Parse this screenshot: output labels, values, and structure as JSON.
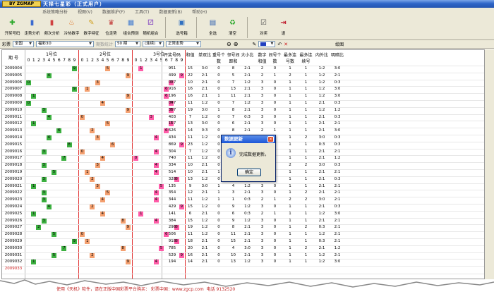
{
  "app": {
    "brand": "BY ZGMAP",
    "title": "天择七星彩（正式用户）"
  },
  "menu": [
    "系统策略分析",
    "视图(V)",
    "数据维护(F)",
    "工具(T)",
    "数据更新(B)",
    "帮助(H)"
  ],
  "toolbar": [
    {
      "label": "开奖号码",
      "icon": "plus-icon",
      "color": "#2aa82a"
    },
    {
      "label": "走势分析",
      "icon": "bar-chart-icon",
      "color": "#3a6ad0"
    },
    {
      "label": "频次分析",
      "icon": "bar-chart-icon",
      "color": "#d04040"
    },
    {
      "label": "冷热数字",
      "icon": "fire-icon",
      "color": "#e07020"
    },
    {
      "label": "数字特征",
      "icon": "pencil-icon",
      "color": "#d0a020"
    },
    {
      "label": "位走势",
      "icon": "cup-icon",
      "color": "#c03030"
    },
    {
      "label": "组合预测",
      "icon": "grid-icon",
      "color": "#4a80d0"
    },
    {
      "label": "随机组合",
      "icon": "dice-icon",
      "color": "#8040c0"
    },
    {
      "label": "选号箱",
      "icon": "box-icon",
      "color": "#3070c0"
    },
    {
      "label": "全选",
      "icon": "select-all-icon",
      "color": "#3060b0"
    },
    {
      "label": "清空",
      "icon": "recycle-icon",
      "color": "#2aa82a"
    },
    {
      "label": "对奖",
      "icon": "check-icon",
      "color": "#505050"
    },
    {
      "label": "退",
      "icon": "exit-icon",
      "color": "#c02030"
    }
  ],
  "filter": {
    "label1": "彩票",
    "sel1": "全国",
    "sel2": "福彩3D",
    "sel3": "期数统计",
    "sel4": "50 期",
    "sel5": "(连续)",
    "sel6": "正常走势",
    "draw_label": "绘图"
  },
  "headers": {
    "issue": "期 号",
    "pos1": "1号位",
    "pos2": "2号位",
    "pos3": "3号位",
    "cols": [
      "开奖号码",
      "和值",
      "单双比",
      "重号个数",
      "邻号间距和",
      "大小比",
      "数字和值",
      "间号个数",
      "最多连号数",
      "最多连续号",
      "内外比",
      "明暗比"
    ]
  },
  "digits": [
    "0",
    "1",
    "2",
    "3",
    "4",
    "5",
    "6",
    "7",
    "8",
    "9"
  ],
  "rows": [
    {
      "issue": "2009004",
      "n": "951",
      "a": [
        "15",
        "3:0",
        "0",
        "8",
        "2:1",
        "2",
        "0",
        "1",
        "1",
        "1:2",
        "3:0"
      ]
    },
    {
      "issue": "2009005",
      "n": "499",
      "a": [
        "22",
        "2:1",
        "0",
        "5",
        "2:1",
        "2",
        "1",
        "2",
        "1",
        "1:2",
        "2:1"
      ]
    },
    {
      "issue": "2009006",
      "n": "037",
      "a": [
        "10",
        "2:1",
        "0",
        "7",
        "1:2",
        "3",
        "0",
        "1",
        "1",
        "1:2",
        "0:3"
      ]
    },
    {
      "issue": "2009007",
      "n": "916",
      "a": [
        "16",
        "2:1",
        "0",
        "13",
        "2:1",
        "3",
        "0",
        "1",
        "1",
        "1:2",
        "3:0"
      ]
    },
    {
      "issue": "2009008",
      "n": "196",
      "a": [
        "16",
        "2:1",
        "1",
        "11",
        "2:1",
        "3",
        "0",
        "1",
        "1",
        "1:2",
        "3:0"
      ]
    },
    {
      "issue": "2009009",
      "n": "047",
      "a": [
        "11",
        "1:2",
        "0",
        "7",
        "1:2",
        "3",
        "0",
        "1",
        "1",
        "2:1",
        "0:3"
      ]
    },
    {
      "issue": "2009010",
      "n": "397",
      "a": [
        "19",
        "3:0",
        "1",
        "8",
        "2:1",
        "3",
        "0",
        "1",
        "1",
        "1:2",
        "1:2"
      ]
    },
    {
      "issue": "2009011",
      "n": "403",
      "a": [
        "7",
        "1:2",
        "0",
        "7",
        "0:3",
        "3",
        "0",
        "1",
        "1",
        "2:1",
        "0:3"
      ]
    },
    {
      "issue": "2009012",
      "n": "157",
      "a": [
        "13",
        "3:0",
        "0",
        "6",
        "2:1",
        "3",
        "0",
        "1",
        "1",
        "2:1",
        "2:1"
      ]
    },
    {
      "issue": "2009013",
      "n": "626",
      "a": [
        "14",
        "0:3",
        "0",
        "8",
        "2:1",
        "2",
        "1",
        "1",
        "1",
        "2:1",
        "3:0"
      ]
    },
    {
      "issue": "2009014",
      "n": "434",
      "a": [
        "11",
        "1:2",
        "0",
        "2",
        "0:3",
        "2",
        "1",
        "1",
        "2",
        "3:0",
        "0:3"
      ]
    },
    {
      "issue": "2009015",
      "n": "869",
      "a": [
        "23",
        "1:2",
        "0",
        "5",
        "3:0",
        "3",
        "0",
        "1",
        "1",
        "0:3",
        "0:3"
      ]
    },
    {
      "issue": "2009016",
      "n": "304",
      "a": [
        "7",
        "1:2",
        "0",
        "7",
        "1:2",
        "3",
        "0",
        "1",
        "1",
        "2:1",
        "2:1"
      ]
    },
    {
      "issue": "2009017",
      "n": "740",
      "a": [
        "11",
        "1:2",
        "0",
        "7",
        "1:2",
        "3",
        "0",
        "1",
        "1",
        "2:1",
        "1:2"
      ]
    },
    {
      "issue": "2009018",
      "n": "334",
      "a": [
        "10",
        "2:1",
        "0",
        "1",
        "0:3",
        "2",
        "1",
        "2",
        "2",
        "3:0",
        "0:3"
      ]
    },
    {
      "issue": "2009019",
      "n": "514",
      "a": [
        "10",
        "2:1",
        "1",
        "7",
        "1:2",
        "3",
        "0",
        "1",
        "1",
        "2:1",
        "2:1"
      ]
    },
    {
      "issue": "2009020",
      "n": "328",
      "a": [
        "13",
        "1:2",
        "0",
        "6",
        "1:2",
        "3",
        "0",
        "1",
        "1",
        "2:1",
        "0:3"
      ]
    },
    {
      "issue": "2009021",
      "n": "135",
      "a": [
        "9",
        "3:0",
        "1",
        "4",
        "1:2",
        "3",
        "0",
        "1",
        "1",
        "2:1",
        "2:1"
      ]
    },
    {
      "issue": "2009022",
      "n": "354",
      "a": [
        "12",
        "2:1",
        "1",
        "3",
        "2:1",
        "3",
        "0",
        "1",
        "2",
        "2:1",
        "2:1"
      ]
    },
    {
      "issue": "2009023",
      "n": "344",
      "a": [
        "11",
        "1:2",
        "1",
        "1",
        "0:3",
        "2",
        "1",
        "2",
        "2",
        "3:0",
        "2:1"
      ]
    },
    {
      "issue": "2009024",
      "n": "429",
      "a": [
        "15",
        "1:2",
        "0",
        "9",
        "1:2",
        "3",
        "0",
        "1",
        "1",
        "2:1",
        "0:3"
      ]
    },
    {
      "issue": "2009025",
      "n": "141",
      "a": [
        "6",
        "2:1",
        "0",
        "6",
        "0:3",
        "2",
        "1",
        "1",
        "1",
        "1:2",
        "3:0"
      ]
    },
    {
      "issue": "2009026",
      "n": "384",
      "a": [
        "15",
        "1:2",
        "0",
        "9",
        "1:2",
        "3",
        "0",
        "1",
        "1",
        "2:1",
        "2:1"
      ]
    },
    {
      "issue": "2009027",
      "n": "298",
      "a": [
        "19",
        "1:2",
        "0",
        "8",
        "2:1",
        "3",
        "0",
        "1",
        "2",
        "0:3",
        "2:1"
      ]
    },
    {
      "issue": "2009028",
      "n": "506",
      "a": [
        "11",
        "1:2",
        "0",
        "11",
        "2:1",
        "3",
        "0",
        "1",
        "1",
        "1:2",
        "2:1"
      ]
    },
    {
      "issue": "2009029",
      "n": "918",
      "a": [
        "18",
        "2:1",
        "0",
        "15",
        "2:1",
        "3",
        "0",
        "1",
        "1",
        "0:3",
        "2:1"
      ]
    },
    {
      "issue": "2009030",
      "n": "785",
      "a": [
        "20",
        "2:1",
        "0",
        "4",
        "3:0",
        "3",
        "0",
        "1",
        "2",
        "2:1",
        "1:2"
      ]
    },
    {
      "issue": "2009031",
      "n": "529",
      "a": [
        "16",
        "2:1",
        "0",
        "10",
        "2:1",
        "3",
        "0",
        "1",
        "1",
        "1:2",
        "2:1"
      ]
    },
    {
      "issue": "2009032",
      "n": "194",
      "a": [
        "14",
        "2:1",
        "0",
        "13",
        "1:2",
        "3",
        "0",
        "1",
        "1",
        "1:2",
        "3:0"
      ]
    },
    {
      "issue": "2009033",
      "n": "",
      "a": [
        "",
        "",
        "",
        "",
        "",
        "",
        "",
        "",
        "",
        "",
        ""
      ]
    }
  ],
  "colors": {
    "green": "#3cb040",
    "orange": "#f4a070",
    "pink": "#ff5ca8",
    "red_line": "#e03030"
  },
  "dialog": {
    "title": "数据更新",
    "message": "完成数据更新。",
    "ok": "确定",
    "icon": "info-icon"
  },
  "footer": "使用《天机》软件，请在正版中国彩票平台购买： 彩票中国：www.zgcp.com  电话 9132520"
}
